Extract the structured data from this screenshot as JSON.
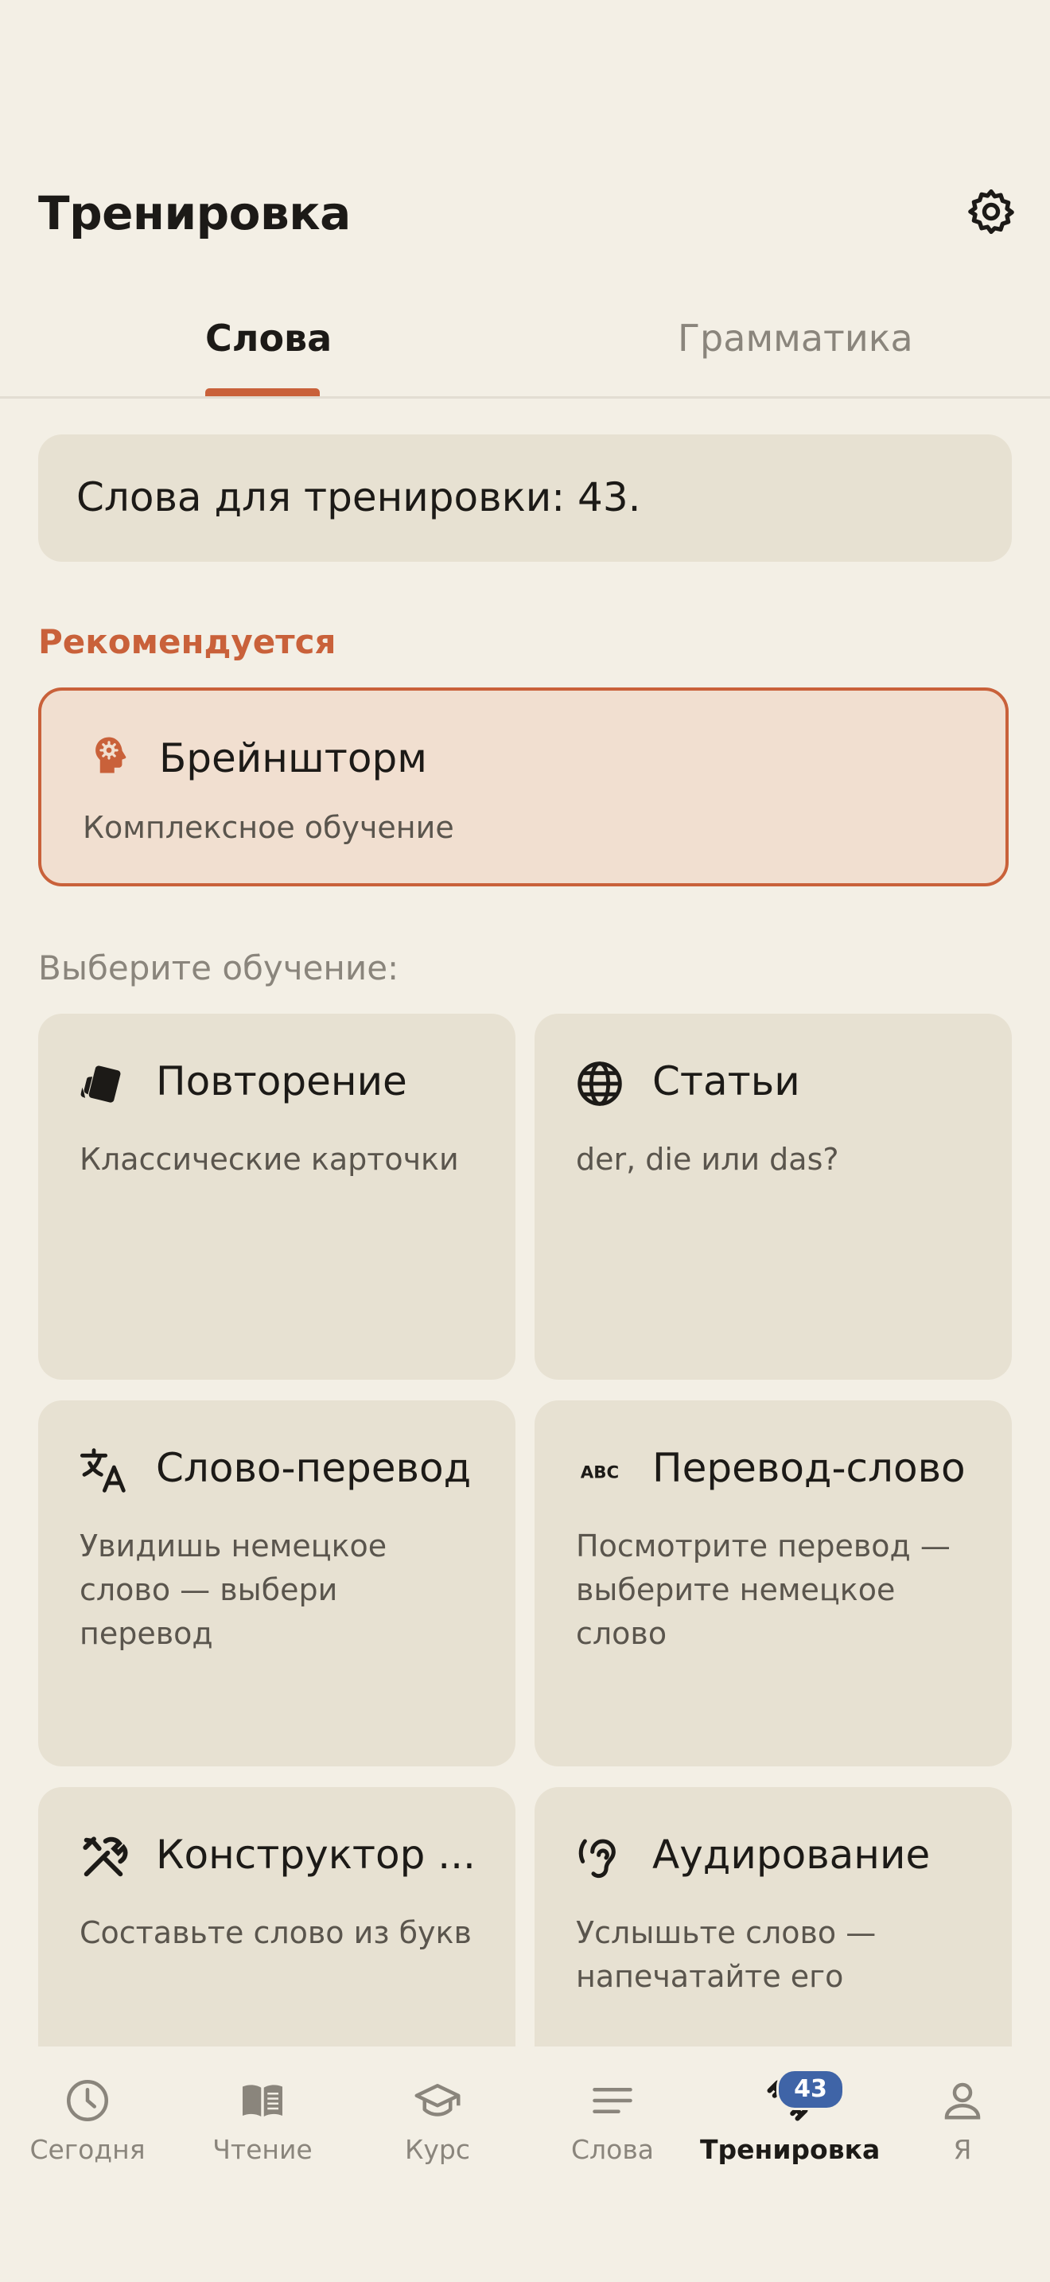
{
  "header": {
    "title": "Тренировка",
    "settings_icon": "gear-icon"
  },
  "tabs": [
    {
      "label": "Слова",
      "active": true
    },
    {
      "label": "Грамматика",
      "active": false
    }
  ],
  "count_banner": {
    "text": "Слова для тренировки: 43."
  },
  "recommended": {
    "heading": "Рекомендуется",
    "card": {
      "icon": "brain-head-icon",
      "title": "Брейншторм",
      "subtitle": "Комплексное обучение"
    }
  },
  "choose_heading": "Выберите обучение:",
  "modes": [
    {
      "icon": "cards-icon",
      "title": "Повторение",
      "subtitle": "Классические карточки"
    },
    {
      "icon": "globe-icon",
      "title": "Статьи",
      "subtitle": "der, die или das?"
    },
    {
      "icon": "translate-icon",
      "title": "Слово-перевод",
      "subtitle": "Увидишь немецкое слово — выбери перевод"
    },
    {
      "icon": "abc-icon",
      "title": "Перевод-слово",
      "subtitle": "Посмотрите перевод — выберите немецкое слово"
    },
    {
      "icon": "tools-icon",
      "title": "Конструктор ...",
      "subtitle": "Составьте слово из букв"
    },
    {
      "icon": "ear-icon",
      "title": "Аудирование",
      "subtitle": "Услышьте слово — напечатайте его"
    }
  ],
  "bottom_nav": [
    {
      "label": "Сегодня",
      "icon": "clock-icon",
      "active": false
    },
    {
      "label": "Чтение",
      "icon": "book-icon",
      "active": false
    },
    {
      "label": "Курс",
      "icon": "graduation-cap-icon",
      "active": false
    },
    {
      "label": "Слова",
      "icon": "lines-icon",
      "active": false
    },
    {
      "label": "Тренировка",
      "icon": "dumbbell-icon",
      "active": true,
      "badge": "43"
    },
    {
      "label": "Я",
      "icon": "person-icon",
      "active": false
    }
  ],
  "colors": {
    "accent": "#c9613a",
    "background": "#f3efe5",
    "card": "#e7e1d2",
    "badge": "#3f64a7"
  }
}
